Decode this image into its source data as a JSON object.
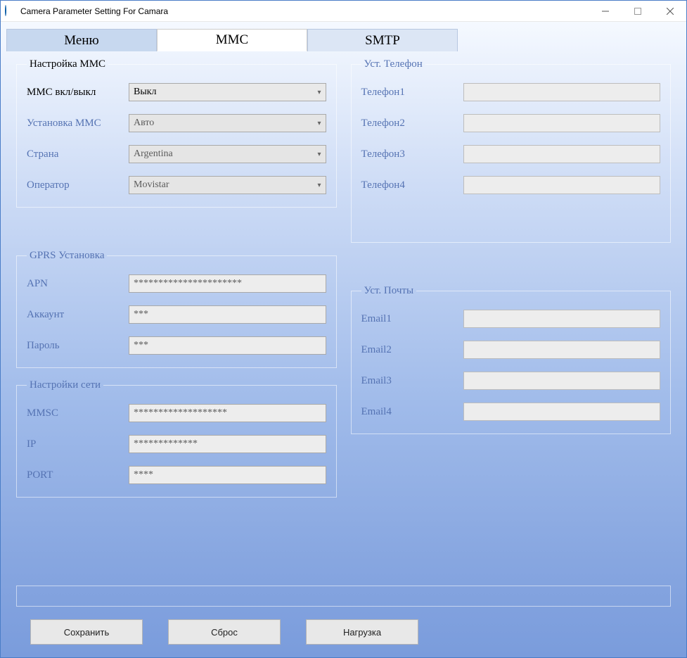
{
  "window": {
    "title": "Camera Parameter Setting For  Camara"
  },
  "tabs": {
    "menu": "Меню",
    "mmc": "MMC",
    "smtp": "SMTP"
  },
  "mmc_setup": {
    "legend": "Настройка MMC",
    "onoff_label": "ММС вкл/выкл",
    "onoff_value": "Выкл",
    "setup_label": "Установка MMC",
    "setup_value": "Авто",
    "country_label": "Страна",
    "country_value": "Argentina",
    "operator_label": "Оператор",
    "operator_value": "Movistar"
  },
  "phone": {
    "legend": "Уст. Телефон",
    "p1_label": "Телефон1",
    "p1_value": "",
    "p2_label": "Телефон2",
    "p2_value": "",
    "p3_label": "Телефон3",
    "p3_value": "",
    "p4_label": "Телефон4",
    "p4_value": ""
  },
  "gprs": {
    "legend": "GPRS Установка",
    "apn_label": "APN",
    "apn_value": "**********************",
    "account_label": "Аккаунт",
    "account_value": "***",
    "password_label": "Пароль",
    "password_value": "***"
  },
  "mail": {
    "legend": "Уст. Почты",
    "e1_label": "Email1",
    "e1_value": "",
    "e2_label": "Email2",
    "e2_value": "",
    "e3_label": "Email3",
    "e3_value": "",
    "e4_label": "Email4",
    "e4_value": ""
  },
  "net": {
    "legend": "Настройки сети",
    "mmsc_label": "MMSC",
    "mmsc_value": "*******************",
    "ip_label": "IP",
    "ip_value": "*************",
    "port_label": "PORT",
    "port_value": "****"
  },
  "buttons": {
    "save": "Сохранить",
    "reset": "Сброс",
    "load": "Нагрузка"
  }
}
